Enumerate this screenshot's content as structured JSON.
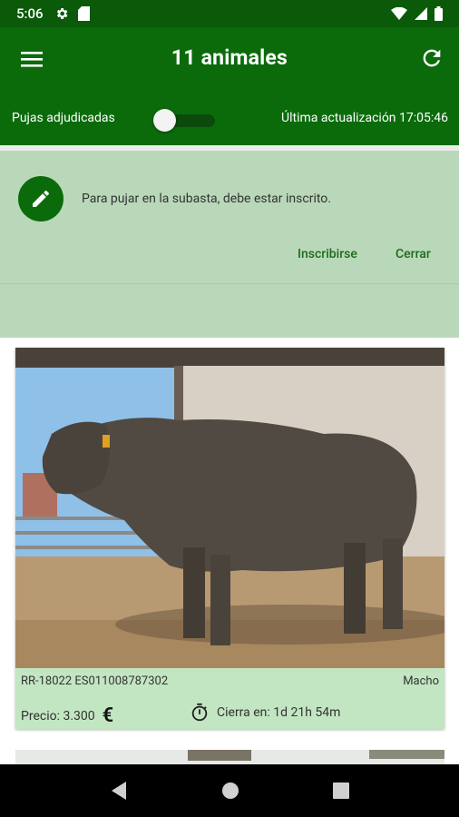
{
  "status_bar": {
    "time": "5:06"
  },
  "app_bar": {
    "title": "11 animales"
  },
  "filter_bar": {
    "toggle_label": "Pujas adjudicadas",
    "toggle_on": false,
    "last_update": "Última actualización 17:05:46"
  },
  "banner": {
    "message": "Para pujar en la subasta, debe estar inscrito.",
    "primary_action": "Inscribirse",
    "secondary_action": "Cerrar"
  },
  "listing": {
    "id_text": "RR-18022 ES011008787302",
    "sex": "Macho",
    "price": "Precio: 3.300",
    "currency_symbol": "€",
    "closes_in": "Cierra en: 1d 21h 54m"
  },
  "colors": {
    "app_bar": "#0b6b0b",
    "banner": "#b9d8b9",
    "card": "#c2e6c2"
  }
}
